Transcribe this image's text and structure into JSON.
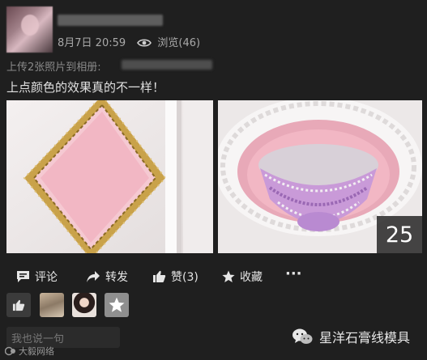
{
  "post": {
    "date_time": "8月7日 20:59",
    "views": "浏览(46)",
    "upload_prefix": "上传2张照片到相册:",
    "text": "上点颜色的效果真的不一样！",
    "photo_count": "25"
  },
  "actions": {
    "comment": "评论",
    "share": "转发",
    "like": "赞(3)",
    "favorite": "收藏",
    "more": "···"
  },
  "comment_placeholder": "我也说一句",
  "watermarks": {
    "left": "大毅网络",
    "right": "星洋石膏线模具"
  },
  "icons": {
    "avatar": "avatar-image",
    "views": "eye-icon",
    "comment": "comment-icon",
    "share": "share-arrow-icon",
    "like": "thumbs-up-icon",
    "favorite": "star-icon",
    "more": "more-dots-icon",
    "wechat": "wechat-icon"
  },
  "colors": {
    "background": "#1f1f1f",
    "pink_panel": "#f2b7c4",
    "gold_trim": "#c9a24a",
    "purple_crystal": "#b98ad1"
  }
}
